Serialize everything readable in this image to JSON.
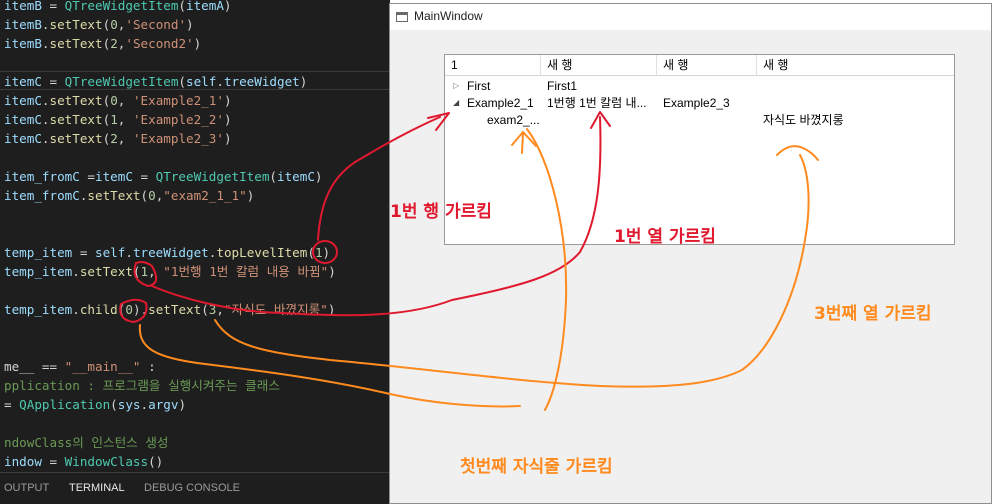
{
  "editor": {
    "lines": [
      {
        "segments": [
          {
            "t": "itemB",
            "c": "v"
          },
          {
            "t": " = ",
            "c": "p"
          },
          {
            "t": "QTreeWidgetItem",
            "c": "c"
          },
          {
            "t": "(",
            "c": "p"
          },
          {
            "t": "itemA",
            "c": "v"
          },
          {
            "t": ")",
            "c": "p"
          }
        ]
      },
      {
        "segments": [
          {
            "t": "itemB",
            "c": "v"
          },
          {
            "t": ".",
            "c": "p"
          },
          {
            "t": "setText",
            "c": "f"
          },
          {
            "t": "(",
            "c": "p"
          },
          {
            "t": "0",
            "c": "n"
          },
          {
            "t": ",",
            "c": "p"
          },
          {
            "t": "'Second'",
            "c": "s"
          },
          {
            "t": ")",
            "c": "p"
          }
        ]
      },
      {
        "segments": [
          {
            "t": "itemB",
            "c": "v"
          },
          {
            "t": ".",
            "c": "p"
          },
          {
            "t": "setText",
            "c": "f"
          },
          {
            "t": "(",
            "c": "p"
          },
          {
            "t": "2",
            "c": "n"
          },
          {
            "t": ",",
            "c": "p"
          },
          {
            "t": "'Second2'",
            "c": "s"
          },
          {
            "t": ")",
            "c": "p"
          }
        ]
      },
      {
        "segments": []
      },
      {
        "segments": [
          {
            "t": "itemC",
            "c": "v"
          },
          {
            "t": " = ",
            "c": "p"
          },
          {
            "t": "QTreeWidgetItem",
            "c": "c"
          },
          {
            "t": "(",
            "c": "p"
          },
          {
            "t": "self",
            "c": "v"
          },
          {
            "t": ".",
            "c": "p"
          },
          {
            "t": "treeWidget",
            "c": "v"
          },
          {
            "t": ")",
            "c": "p"
          }
        ]
      },
      {
        "segments": [
          {
            "t": "itemC",
            "c": "v"
          },
          {
            "t": ".",
            "c": "p"
          },
          {
            "t": "setText",
            "c": "f"
          },
          {
            "t": "(",
            "c": "p"
          },
          {
            "t": "0",
            "c": "n"
          },
          {
            "t": ", ",
            "c": "p"
          },
          {
            "t": "'Example2_1'",
            "c": "s"
          },
          {
            "t": ")",
            "c": "p"
          }
        ]
      },
      {
        "segments": [
          {
            "t": "itemC",
            "c": "v"
          },
          {
            "t": ".",
            "c": "p"
          },
          {
            "t": "setText",
            "c": "f"
          },
          {
            "t": "(",
            "c": "p"
          },
          {
            "t": "1",
            "c": "n"
          },
          {
            "t": ", ",
            "c": "p"
          },
          {
            "t": "'Example2_2'",
            "c": "s"
          },
          {
            "t": ")",
            "c": "p"
          }
        ]
      },
      {
        "segments": [
          {
            "t": "itemC",
            "c": "v"
          },
          {
            "t": ".",
            "c": "p"
          },
          {
            "t": "setText",
            "c": "f"
          },
          {
            "t": "(",
            "c": "p"
          },
          {
            "t": "2",
            "c": "n"
          },
          {
            "t": ", ",
            "c": "p"
          },
          {
            "t": "'Example2_3'",
            "c": "s"
          },
          {
            "t": ")",
            "c": "p"
          }
        ]
      },
      {
        "segments": []
      },
      {
        "segments": [
          {
            "t": "item_fromC",
            "c": "v"
          },
          {
            "t": " =",
            "c": "p"
          },
          {
            "t": "itemC",
            "c": "v"
          },
          {
            "t": " = ",
            "c": "p"
          },
          {
            "t": "QTreeWidgetItem",
            "c": "c"
          },
          {
            "t": "(",
            "c": "p"
          },
          {
            "t": "itemC",
            "c": "v"
          },
          {
            "t": ")",
            "c": "p"
          }
        ]
      },
      {
        "segments": [
          {
            "t": "item_fromC",
            "c": "v"
          },
          {
            "t": ".",
            "c": "p"
          },
          {
            "t": "setText",
            "c": "f"
          },
          {
            "t": "(",
            "c": "p"
          },
          {
            "t": "0",
            "c": "n"
          },
          {
            "t": ",",
            "c": "p"
          },
          {
            "t": "\"exam2_1_1\"",
            "c": "s"
          },
          {
            "t": ")",
            "c": "p"
          }
        ]
      },
      {
        "segments": []
      },
      {
        "segments": []
      },
      {
        "segments": [
          {
            "t": "temp_item",
            "c": "v"
          },
          {
            "t": " = ",
            "c": "p"
          },
          {
            "t": "self",
            "c": "v"
          },
          {
            "t": ".",
            "c": "p"
          },
          {
            "t": "treeWidget",
            "c": "v"
          },
          {
            "t": ".",
            "c": "p"
          },
          {
            "t": "topLevelItem",
            "c": "f"
          },
          {
            "t": "(",
            "c": "p"
          },
          {
            "t": "1",
            "c": "n"
          },
          {
            "t": ")",
            "c": "p"
          }
        ]
      },
      {
        "segments": [
          {
            "t": "temp_item",
            "c": "v"
          },
          {
            "t": ".",
            "c": "p"
          },
          {
            "t": "setText",
            "c": "f"
          },
          {
            "t": "(",
            "c": "p"
          },
          {
            "t": "1",
            "c": "n"
          },
          {
            "t": ", ",
            "c": "p"
          },
          {
            "t": "\"1번행 1번 칼럼 내용 바뀜\"",
            "c": "s"
          },
          {
            "t": ")",
            "c": "p"
          }
        ]
      },
      {
        "segments": []
      },
      {
        "segments": [
          {
            "t": "temp_item",
            "c": "v"
          },
          {
            "t": ".",
            "c": "p"
          },
          {
            "t": "child",
            "c": "f"
          },
          {
            "t": "(",
            "c": "p"
          },
          {
            "t": "0",
            "c": "n"
          },
          {
            "t": ").",
            "c": "p"
          },
          {
            "t": "setText",
            "c": "f"
          },
          {
            "t": "(",
            "c": "p"
          },
          {
            "t": "3",
            "c": "n"
          },
          {
            "t": ",",
            "c": "p"
          },
          {
            "t": "\"자식도 바꼈지롱\"",
            "c": "s"
          },
          {
            "t": ")",
            "c": "p"
          }
        ]
      },
      {
        "segments": []
      },
      {
        "segments": []
      },
      {
        "segments": [
          {
            "t": "me__ == ",
            "c": "p"
          },
          {
            "t": "\"__main__\"",
            "c": "s"
          },
          {
            "t": " :",
            "c": "p"
          }
        ]
      },
      {
        "segments": [
          {
            "t": "pplication : 프로그램을 실행시켜주는 클래스",
            "c": "m"
          }
        ]
      },
      {
        "segments": [
          {
            "t": "= ",
            "c": "p"
          },
          {
            "t": "QApplication",
            "c": "c"
          },
          {
            "t": "(",
            "c": "p"
          },
          {
            "t": "sys",
            "c": "v"
          },
          {
            "t": ".",
            "c": "p"
          },
          {
            "t": "argv",
            "c": "v"
          },
          {
            "t": ")",
            "c": "p"
          }
        ]
      },
      {
        "segments": []
      },
      {
        "segments": [
          {
            "t": "ndowClass의 인스턴스 생성",
            "c": "m"
          }
        ]
      },
      {
        "segments": [
          {
            "t": "indow",
            "c": "v"
          },
          {
            "t": " = ",
            "c": "p"
          },
          {
            "t": "WindowClass",
            "c": "c"
          },
          {
            "t": "()",
            "c": "p"
          }
        ]
      }
    ],
    "panel_tabs": [
      "OUTPUT",
      "TERMINAL",
      "DEBUG CONSOLE"
    ],
    "active_tab": "TERMINAL"
  },
  "window": {
    "title": "MainWindow",
    "tree": {
      "headers": [
        "1",
        "새 행",
        "새 행",
        "새 행"
      ],
      "rows": [
        {
          "cells": [
            "First",
            "First1",
            "",
            ""
          ],
          "indent": 0,
          "expander": "collapsed"
        },
        {
          "cells": [
            "Example2_1",
            "1번행 1번 칼럼 내...",
            "Example2_3",
            ""
          ],
          "indent": 0,
          "expander": "expanded"
        },
        {
          "cells": [
            "exam2_...",
            "",
            "",
            "자식도 바꼈지롱"
          ],
          "indent": 1,
          "expander": "none"
        }
      ]
    }
  },
  "annotations": {
    "row_label": "1번 행 가르킴",
    "col1_label": "1번 열 가르킴",
    "col3_label": "3번째 열 가르킴",
    "child_label": "첫번째 자식줄 가르킴",
    "colors": {
      "red": "#e0192f",
      "orange": "#ff8a1e"
    }
  }
}
